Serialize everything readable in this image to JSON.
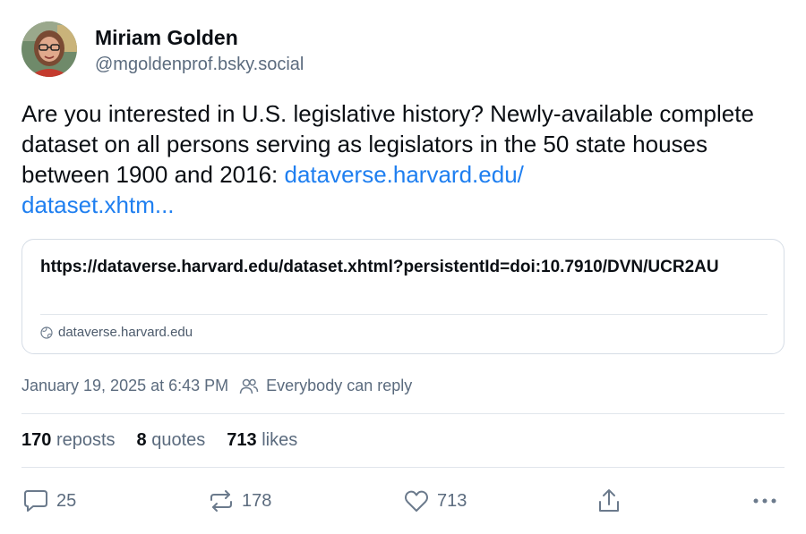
{
  "author": {
    "display_name": "Miriam Golden",
    "handle": "@mgoldenprof.bsky.social",
    "avatar_icon": "profile-photo"
  },
  "post": {
    "text": "Are you interested in U.S. legislative history? Newly-available complete dataset on all persons serving as legislators in the 50 state houses between 1900 and 2016: ",
    "link_line1": "dataverse.harvard.edu/",
    "link_line2": "dataset.xhtm...",
    "link_color": "#1f7ff0"
  },
  "embed": {
    "title": "https://dataverse.harvard.edu/dataset.xhtml?persistentId=doi:10.7910/DVN/UCR2AU",
    "domain": "dataverse.harvard.edu",
    "domain_icon": "globe-icon"
  },
  "meta": {
    "timestamp": "January 19, 2025 at 6:43 PM",
    "reply_setting": "Everybody can reply",
    "reply_icon": "people-icon"
  },
  "stats": {
    "reposts_count": "170",
    "reposts_label": "reposts",
    "quotes_count": "8",
    "quotes_label": "quotes",
    "likes_count": "713",
    "likes_label": "likes"
  },
  "actions": {
    "reply_count": "25",
    "repost_count": "178",
    "like_count": "713",
    "icons": [
      "reply-icon",
      "repost-icon",
      "like-icon",
      "share-icon",
      "more-icon"
    ]
  }
}
